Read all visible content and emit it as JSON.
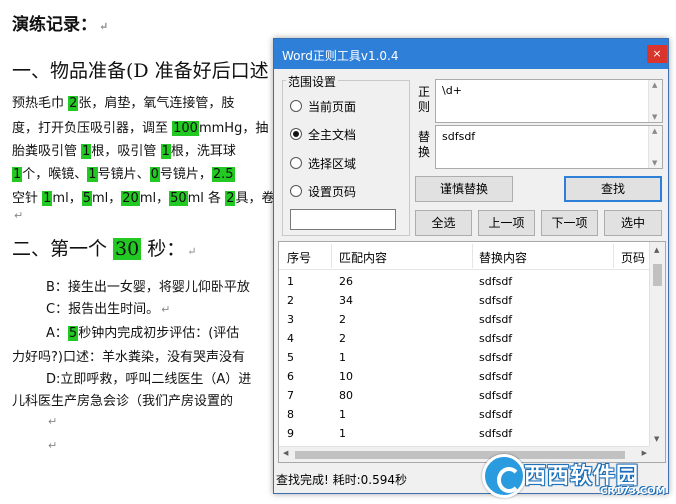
{
  "document": {
    "heading": "演练记录：",
    "para_mark": "↵",
    "section1": "一、物品准备(D 准备好后口述",
    "lines": [
      {
        "parts": [
          {
            "t": "预热毛巾 "
          },
          {
            "t": "2",
            "h": true
          },
          {
            "t": "张，肩垫，氧气连接管，肢"
          }
        ]
      },
      {
        "parts": [
          {
            "t": "度，打开负压吸引器，调至 "
          },
          {
            "t": "100",
            "h": true
          },
          {
            "t": "mmHg，抽"
          }
        ]
      },
      {
        "parts": [
          {
            "t": "胎粪吸引管 "
          },
          {
            "t": "1",
            "h": true
          },
          {
            "t": "根，吸引管 "
          },
          {
            "t": "1",
            "h": true
          },
          {
            "t": "根，洗耳球"
          }
        ]
      },
      {
        "parts": [
          {
            "t": "1",
            "h": true
          },
          {
            "t": "个，喉镜、"
          },
          {
            "t": "1",
            "h": true
          },
          {
            "t": "号镜片、"
          },
          {
            "t": "0",
            "h": true
          },
          {
            "t": "号镜片，"
          },
          {
            "t": "2.5",
            "h": true
          }
        ]
      },
      {
        "parts": [
          {
            "t": "空针 "
          },
          {
            "t": "1",
            "h": true
          },
          {
            "t": "ml，"
          },
          {
            "t": "5",
            "h": true
          },
          {
            "t": "ml，"
          },
          {
            "t": "20",
            "h": true
          },
          {
            "t": "ml，"
          },
          {
            "t": "50",
            "h": true
          },
          {
            "t": "ml 各 "
          },
          {
            "t": "2",
            "h": true
          },
          {
            "t": "具，卷"
          }
        ]
      }
    ],
    "section2_prefix": "二、第一个 ",
    "section2_num": "30",
    "section2_suffix": " 秒：",
    "b_line": "B：接生出一女婴，将婴儿仰卧平放",
    "c_line": "C：报告出生时间。",
    "a_prefix": "A：",
    "a_num": "5",
    "a_suffix": "秒钟内完成初步评估：(评估",
    "a_cont": "力好吗?)口述：羊水粪染，没有哭声没有",
    "d_line": "D:立即呼救，呼叫二线医生（A）进",
    "d_cont": "儿科医生产房急会诊（我们产房设置的"
  },
  "dialog": {
    "title": "Word正则工具v1.0.4",
    "close": "×",
    "scope_label": "范围设置",
    "scope_options": [
      "当前页面",
      "全主文档",
      "选择区域",
      "设置页码"
    ],
    "selected_scope": "全主文档",
    "page_input_value": "",
    "regex_label": "正则",
    "regex_value": "\\d+",
    "replace_label": "替换",
    "replace_value": "sdfsdf",
    "buttons": {
      "careful_replace": "谨慎替换",
      "find": "查找",
      "select_all": "全选",
      "prev": "上一项",
      "next": "下一项",
      "select_in": "选中"
    },
    "table": {
      "headers": [
        "序号",
        "匹配内容",
        "替换内容",
        "页码"
      ],
      "rows": [
        [
          "1",
          "26",
          "sdfsdf"
        ],
        [
          "2",
          "34",
          "sdfsdf"
        ],
        [
          "3",
          "2",
          "sdfsdf"
        ],
        [
          "4",
          "2",
          "sdfsdf"
        ],
        [
          "5",
          "1",
          "sdfsdf"
        ],
        [
          "6",
          "10",
          "sdfsdf"
        ],
        [
          "7",
          "80",
          "sdfsdf"
        ],
        [
          "8",
          "1",
          "sdfsdf"
        ],
        [
          "9",
          "1",
          "sdfsdf"
        ]
      ]
    },
    "status": "查找完成! 耗时:0.594秒"
  },
  "watermark": {
    "text": "西西软件园",
    "sub": "CR173.COM"
  },
  "colors": {
    "highlight": "#22c922",
    "titlebar": "#2d7fd8",
    "close": "#d9352c"
  }
}
